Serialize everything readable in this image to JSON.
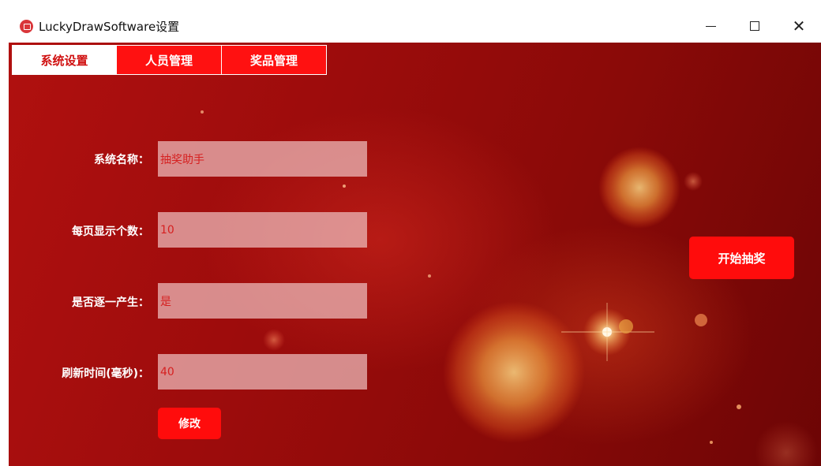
{
  "window": {
    "title": "LuckyDrawSoftware设置",
    "app_icon": "app-icon",
    "controls": {
      "minimize": "minimize-icon",
      "maximize": "maximize-icon",
      "close": "close-icon"
    }
  },
  "tabs": [
    {
      "label": "系统设置",
      "active": true
    },
    {
      "label": "人员管理",
      "active": false
    },
    {
      "label": "奖品管理",
      "active": false
    }
  ],
  "form": {
    "fields": [
      {
        "label": "系统名称：",
        "value": "抽奖助手"
      },
      {
        "label": "每页显示个数：",
        "value": "10"
      },
      {
        "label": "是否逐一产生：",
        "value": "是"
      },
      {
        "label": "刷新时间(毫秒)：",
        "value": "40"
      }
    ],
    "modify_label": "修改"
  },
  "start_label": "开始抽奖",
  "colors": {
    "accent": "#ff0c0c",
    "background": "#9d0c0c",
    "input_text": "#d62020"
  }
}
